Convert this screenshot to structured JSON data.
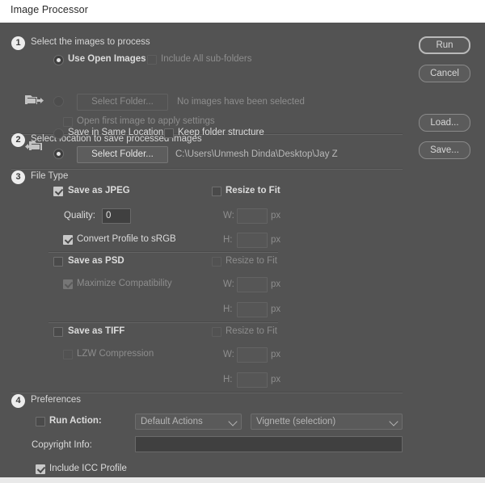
{
  "window": {
    "title": "Image Processor"
  },
  "buttons": {
    "run": "Run",
    "cancel": "Cancel",
    "load": "Load...",
    "save": "Save..."
  },
  "step1": {
    "number": "1",
    "title": "Select the images to process",
    "use_open_images": "Use Open Images",
    "include_subfolders": "Include All sub-folders",
    "select_folder": "Select Folder...",
    "status": "No images have been selected",
    "open_first_image": "Open first image to apply settings"
  },
  "step2": {
    "number": "2",
    "title": "Select location to save processed images",
    "save_same_location": "Save in Same Location",
    "keep_folder_structure": "Keep folder structure",
    "select_folder": "Select Folder...",
    "path": "C:\\Users\\Unmesh Dinda\\Desktop\\Jay Z"
  },
  "step3": {
    "number": "3",
    "title": "File Type",
    "jpeg": {
      "save_label": "Save as JPEG",
      "quality_label": "Quality:",
      "quality_value": "0",
      "convert_srgb": "Convert Profile to sRGB",
      "resize_to_fit": "Resize to Fit",
      "w_label": "W:",
      "w_value": "",
      "h_label": "H:",
      "h_value": "",
      "unit": "px"
    },
    "psd": {
      "save_label": "Save as PSD",
      "maximize_compat": "Maximize Compatibility",
      "resize_to_fit": "Resize to Fit",
      "w_label": "W:",
      "w_value": "",
      "h_label": "H:",
      "h_value": "",
      "unit": "px"
    },
    "tiff": {
      "save_label": "Save as TIFF",
      "lzw": "LZW Compression",
      "resize_to_fit": "Resize to Fit",
      "w_label": "W:",
      "w_value": "",
      "h_label": "H:",
      "h_value": "",
      "unit": "px"
    }
  },
  "step4": {
    "number": "4",
    "title": "Preferences",
    "run_action": "Run Action:",
    "action_set": "Default Actions",
    "action_name": "Vignette (selection)",
    "copyright_label": "Copyright Info:",
    "copyright_value": "",
    "include_icc": "Include ICC Profile"
  }
}
